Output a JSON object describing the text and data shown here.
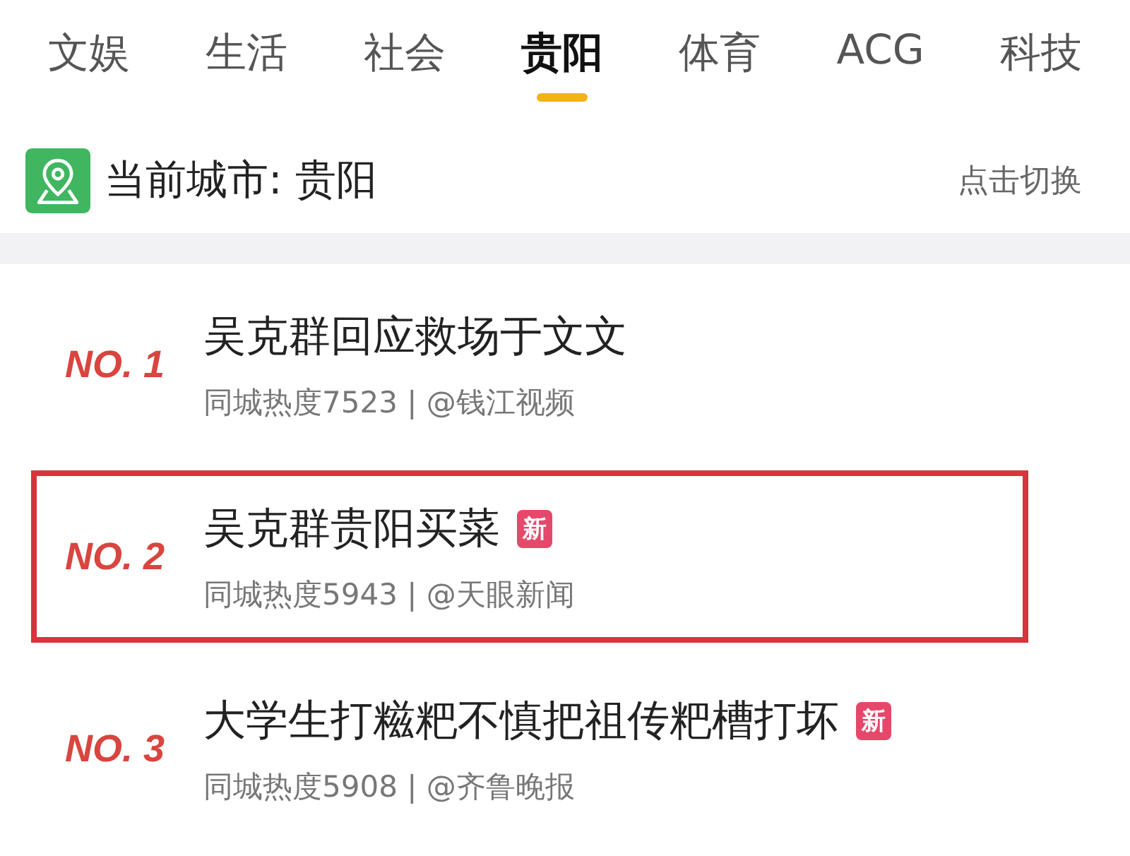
{
  "tabs": [
    {
      "label": "文娱",
      "selected": false
    },
    {
      "label": "生活",
      "selected": false
    },
    {
      "label": "社会",
      "selected": false
    },
    {
      "label": "贵阳",
      "selected": true
    },
    {
      "label": "体育",
      "selected": false
    },
    {
      "label": "ACG",
      "selected": false
    },
    {
      "label": "科技",
      "selected": false
    }
  ],
  "city_bar": {
    "label": "当前城市: 贵阳",
    "action": "点击切换"
  },
  "items": [
    {
      "rank": "NO. 1",
      "title": "吴克群回应救场于文文",
      "meta": "同城热度7523 | @钱江视频",
      "highlighted": false
    },
    {
      "rank": "NO. 2",
      "title": "吴克群贵阳买菜",
      "badge": "新",
      "meta": "同城热度5943 | @天眼新闻",
      "highlighted": true
    },
    {
      "rank": "NO. 3",
      "title": "大学生打糍粑不慎把祖传粑槽打坏",
      "badge": "新",
      "meta": "同城热度5908 | @齐鲁晚报",
      "highlighted": false
    }
  ]
}
